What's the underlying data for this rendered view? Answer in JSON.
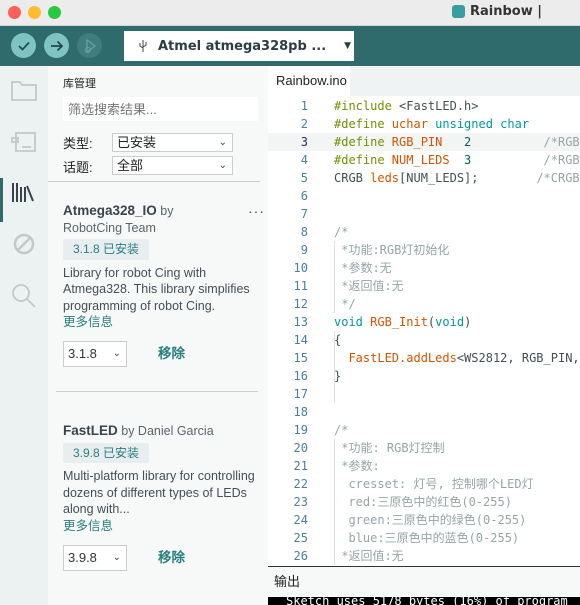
{
  "window": {
    "title": "Rainbow |",
    "traffic_colors": [
      "#fe5f57",
      "#febc2e",
      "#28c840"
    ]
  },
  "toolbar": {
    "verify_icon": "check-icon",
    "upload_icon": "arrow-right-icon",
    "debug_icon": "debug-icon",
    "board": "Atmel atmega328pb ..."
  },
  "rail": {
    "items": [
      "folder-icon",
      "board-icon",
      "library-icon",
      "debug-disabled-icon",
      "search-icon"
    ],
    "active": "library-icon"
  },
  "library_manager": {
    "title": "库管理",
    "filter_placeholder": "筛选搜索结果...",
    "type_label": "类型:",
    "type_value": "已安装",
    "topic_label": "话题:",
    "topic_value": "全部",
    "libraries": [
      {
        "name": "Atmega328_IO",
        "by": " by",
        "author": "RobotCing Team",
        "badge": "3.1.8 已安装",
        "description": "Library for robot Cing with Atmega328. This library simplifies programming of robot Cing.",
        "more": "更多信息",
        "version": "3.1.8",
        "remove": "移除",
        "menu": "···"
      },
      {
        "name": "FastLED",
        "by": " by ",
        "author": "Daniel Garcia",
        "badge": "3.9.8 已安装",
        "description": "Multi-platform library for controlling dozens of different types of LEDs along with...",
        "more": "更多信息",
        "version": "3.9.8",
        "remove": "移除"
      }
    ]
  },
  "editor": {
    "tab": "Rainbow.ino",
    "current_line": 3,
    "lines": [
      [
        [
          "#include ",
          "dir"
        ],
        [
          "<FastLED.h>",
          "def"
        ]
      ],
      [
        [
          "#define ",
          "dir"
        ],
        [
          "uchar ",
          "id"
        ],
        [
          "unsigned char",
          "kw"
        ]
      ],
      [
        [
          "#define ",
          "dir"
        ],
        [
          "RGB_PIN",
          "id"
        ],
        [
          "   2",
          "num"
        ],
        [
          "          /*RGB灯",
          "cm"
        ]
      ],
      [
        [
          "#define ",
          "dir"
        ],
        [
          "NUM_LEDS",
          "id"
        ],
        [
          "  3",
          "num"
        ],
        [
          "          /*RGB灯",
          "cm"
        ]
      ],
      [
        [
          "CRGB ",
          "def"
        ],
        [
          "leds",
          "id"
        ],
        [
          "[NUM_LEDS];",
          "def"
        ],
        [
          "        /*CRGB",
          "cm"
        ]
      ],
      [],
      [],
      [
        [
          "/*",
          "cm"
        ]
      ],
      [
        [
          " *功能:RGB灯初始化",
          "cm"
        ]
      ],
      [
        [
          " *参数:无",
          "cm"
        ]
      ],
      [
        [
          " *返回值:无",
          "cm"
        ]
      ],
      [
        [
          " */",
          "cm"
        ]
      ],
      [
        [
          "void ",
          "kw"
        ],
        [
          "RGB_Init",
          "id"
        ],
        [
          "(",
          "def"
        ],
        [
          "void",
          "kw"
        ],
        [
          ")",
          "def"
        ]
      ],
      [
        [
          "{",
          "def"
        ]
      ],
      [
        [
          "  FastLED.addLeds",
          "id"
        ],
        [
          "<WS2812, RGB_PIN,",
          "def"
        ]
      ],
      [
        [
          "}",
          "def"
        ]
      ],
      [],
      [],
      [
        [
          "/*",
          "cm"
        ]
      ],
      [
        [
          " *功能: RGB灯控制",
          "cm"
        ]
      ],
      [
        [
          " *参数:",
          "cm"
        ]
      ],
      [
        [
          "  cresset: 灯号, 控制哪个LED灯",
          "cm"
        ]
      ],
      [
        [
          "  red:三原色中的红色(0-255)",
          "cm"
        ]
      ],
      [
        [
          "  green:三原色中的绿色(0-255)",
          "cm"
        ]
      ],
      [
        [
          "  blue:三原色中的蓝色(0-255)",
          "cm"
        ]
      ],
      [
        [
          " *返回值:无",
          "cm"
        ]
      ]
    ],
    "colors": {
      "dir": "#728e00",
      "id": "#d35400",
      "kw": "#00979c",
      "def": "#434f54",
      "cm": "#95a5a6",
      "num": "#005c5f"
    }
  },
  "output": {
    "title": "输出",
    "text": "Sketch uses 5178 bytes (16%) of program"
  },
  "colors": {
    "toolbar": "#2f6b6d",
    "accent": "#2a7f80"
  }
}
